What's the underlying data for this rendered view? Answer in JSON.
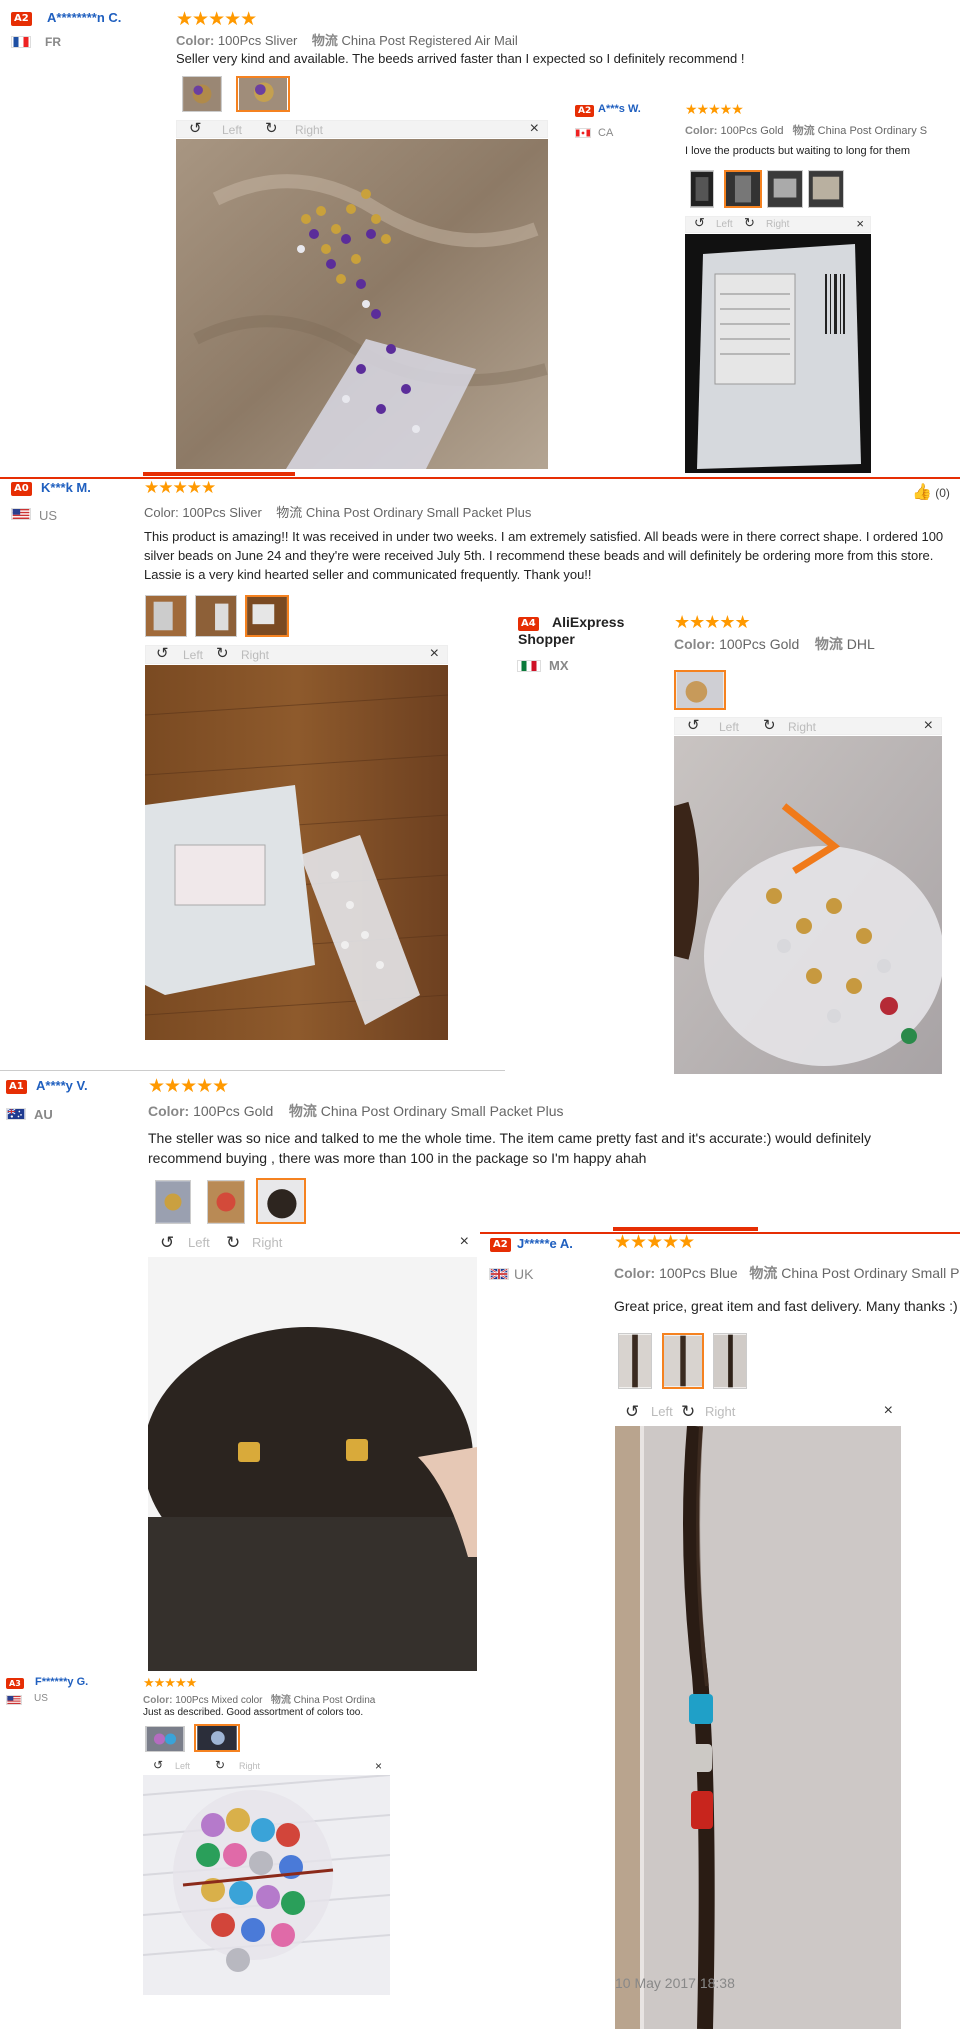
{
  "reviews": [
    {
      "level": "A2",
      "name": "A********n C.",
      "country": "FR",
      "color_label": "Color:",
      "color": "100Pcs Sliver",
      "ship_label": "物流",
      "shipping": "China Post Registered Air Mail",
      "text": "Seller very kind and available. The beeds arrived faster than I expected so I definitely recommend !",
      "viewer": {
        "left": "Left",
        "right": "Right",
        "close": "×"
      }
    },
    {
      "level": "A2",
      "name": "A***s W.",
      "country": "CA",
      "color_label": "Color:",
      "color": "100Pcs Gold",
      "ship_label": "物流",
      "shipping": "China Post Ordinary S",
      "text": "I love the products but waiting to long for them",
      "viewer": {
        "left": "Left",
        "right": "Right",
        "close": "×"
      }
    },
    {
      "level": "A0",
      "name": "K***k M.",
      "country": "US",
      "color_label": "Color:",
      "color": "100Pcs Sliver",
      "ship_label": "物流",
      "shipping": "China Post Ordinary Small Packet Plus",
      "text": "This product is amazing!! It was received in under two weeks. I am extremely satisfied. All beads were in there correct shape. I ordered 100 silver beads on June 24 and they're were received July 5th. I recommend these beads and will definitely be ordering more from this store. Lassie is a very kind hearted seller and communicated frequently. Thank you!!",
      "likes": "(0)",
      "viewer": {
        "left": "Left",
        "right": "Right",
        "close": "×"
      }
    },
    {
      "level": "A4",
      "name": "AliExpress Shopper",
      "country": "MX",
      "color_label": "Color:",
      "color": "100Pcs Gold",
      "ship_label": "物流",
      "shipping": "DHL",
      "text": "",
      "viewer": {
        "left": "Left",
        "right": "Right",
        "close": "×"
      }
    },
    {
      "level": "A1",
      "name": "A****y V.",
      "country": "AU",
      "color_label": "Color:",
      "color": "100Pcs Gold",
      "ship_label": "物流",
      "shipping": "China Post Ordinary Small Packet Plus",
      "text": "The steller was so nice and talked to me the whole time. The item came pretty fast and it's accurate:) would definitely recommend buying , there was more than 100 in the package so I'm happy ahah",
      "viewer": {
        "left": "Left",
        "right": "Right",
        "close": "×"
      }
    },
    {
      "level": "A2",
      "name": "J*****e A.",
      "country": "UK",
      "color_label": "Color:",
      "color": "100Pcs Blue",
      "ship_label": "物流",
      "shipping": "China Post Ordinary Small Pack",
      "text": "Great price, great item and fast delivery. Many thanks :)",
      "date": "10 May 2017 18:38",
      "viewer": {
        "left": "Left",
        "right": "Right",
        "close": "×"
      }
    },
    {
      "level": "A3",
      "name": "F******y G.",
      "country": "US",
      "color_label": "Color:",
      "color": "100Pcs Mixed color",
      "ship_label": "物流",
      "shipping": "China Post Ordina",
      "text": "Just as described. Good assortment of colors too.",
      "viewer": {
        "left": "Left",
        "right": "Right",
        "close": "×"
      }
    }
  ],
  "stars": "★★★★★",
  "colors": {
    "accent": "#e62e04",
    "star": "#ff9900",
    "selected_thumb": "#f58220",
    "name": "#1f5fbf"
  },
  "icons": [
    "rotate-left-icon",
    "rotate-right-icon",
    "close-icon",
    "flag-icon",
    "like-icon"
  ]
}
